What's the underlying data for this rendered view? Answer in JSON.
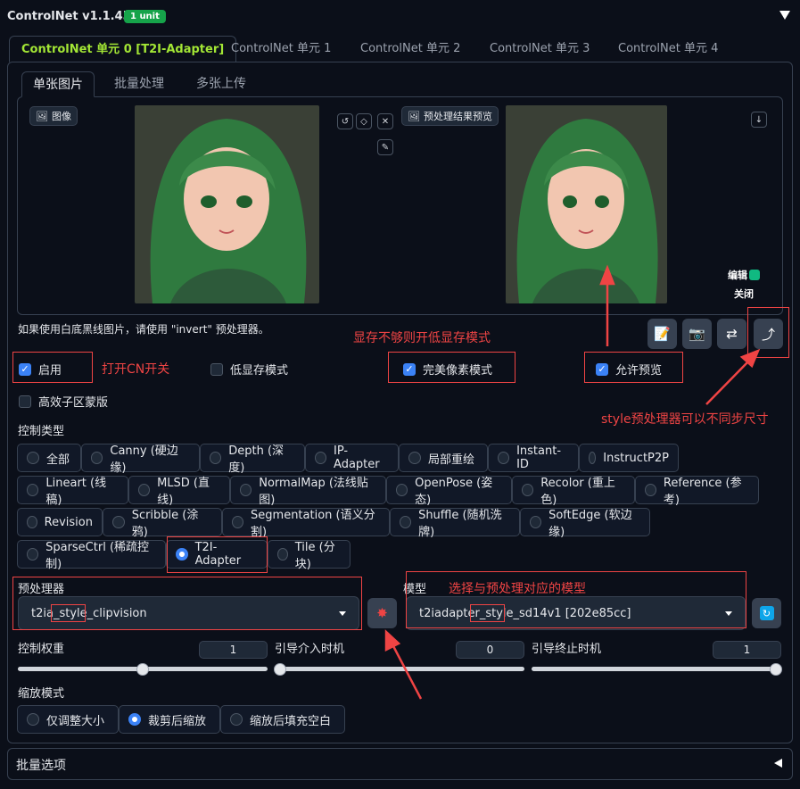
{
  "header": {
    "title": "ControlNet v1.1.455",
    "badge": "1 unit"
  },
  "unit_tabs": [
    {
      "label": "ControlNet 单元 0 [T2I-Adapter]"
    },
    {
      "label": "ControlNet 单元 1"
    },
    {
      "label": "ControlNet 单元 2"
    },
    {
      "label": "ControlNet 单元 3"
    },
    {
      "label": "ControlNet 单元 4"
    }
  ],
  "image_tabs": [
    {
      "label": "单张图片"
    },
    {
      "label": "批量处理"
    },
    {
      "label": "多张上传"
    }
  ],
  "image_panel": {
    "input_label": "图像",
    "preview_label": "预处理结果预览",
    "edit_label": "编辑",
    "close_label": "关闭",
    "invert_hint": "如果使用白底黑线图片，请使用 \"invert\" 预处理器。"
  },
  "options": {
    "enable": "启用",
    "low_vram": "低显存模式",
    "pixel_perfect": "完美像素模式",
    "allow_preview": "允许预览",
    "efficient_mask": "高效子区蒙版"
  },
  "control_type": {
    "label": "控制类型",
    "rows": [
      [
        "全部",
        "Canny (硬边缘)",
        "Depth (深度)",
        "IP-Adapter",
        "局部重绘",
        "Instant-ID",
        "InstructP2P"
      ],
      [
        "Lineart (线稿)",
        "MLSD (直线)",
        "NormalMap (法线贴图)",
        "OpenPose (姿态)",
        "Recolor (重上色)",
        "Reference (参考)"
      ],
      [
        "Revision",
        "Scribble (涂鸦)",
        "Segmentation (语义分割)",
        "Shuffle (随机洗牌)",
        "SoftEdge (软边缘)"
      ],
      [
        "SparseCtrl (稀疏控制)",
        "T2I-Adapter",
        "Tile (分块)"
      ]
    ],
    "selected": "T2I-Adapter"
  },
  "preprocessor": {
    "label": "预处理器",
    "value": "t2ia_style_clipvision"
  },
  "model": {
    "label": "模型",
    "value": "t2iadapter_style_sd14v1 [202e85cc]"
  },
  "sliders": {
    "weight": {
      "label": "控制权重",
      "value": "1",
      "level": 0.5
    },
    "start": {
      "label": "引导介入时机",
      "value": "0",
      "level": 0
    },
    "end": {
      "label": "引导终止时机",
      "value": "1",
      "level": 1
    }
  },
  "resize_mode": {
    "label": "缩放模式",
    "options": [
      "仅调整大小",
      "裁剪后缩放",
      "缩放后填充空白"
    ],
    "selected": "裁剪后缩放"
  },
  "batch_options": {
    "label": "批量选项"
  },
  "annotations": {
    "low_vram_note": "显存不够则开低显存模式",
    "enable_note": "打开CN开关",
    "style_note": "style预处理器可以不同步尺寸",
    "model_note": "选择与预处理对应的模型"
  },
  "colors": {
    "accent": "#a3e635",
    "badge": "#16a34a",
    "checkbox": "#3b82f6",
    "annotation": "#ef4444"
  }
}
